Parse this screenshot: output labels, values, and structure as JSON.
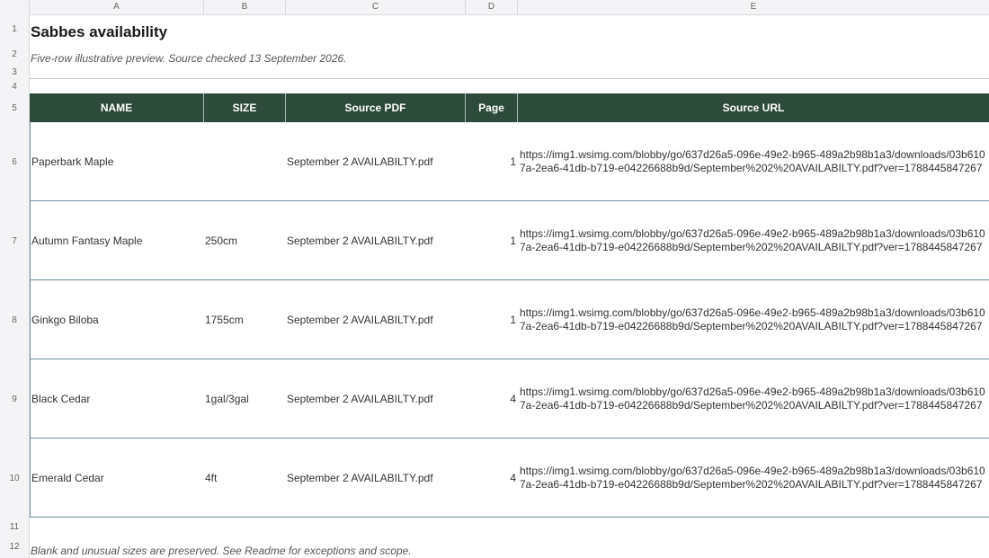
{
  "sheet": {
    "column_letters": [
      "A",
      "B",
      "C",
      "D",
      "E"
    ],
    "row_numbers": [
      "1",
      "2",
      "3",
      "4",
      "5",
      "6",
      "7",
      "8",
      "9",
      "10",
      "11",
      "12"
    ],
    "title": "Sabbes availability",
    "subtitle": "Five-row illustrative preview. Source checked 13 September 2026.",
    "footer_note": "Blank and unusual sizes are preserved. See Readme for exceptions and scope."
  },
  "table": {
    "headers": [
      "NAME",
      "SIZE",
      "Source PDF",
      "Page",
      "Source URL"
    ],
    "header_color": "#2e4a3b",
    "rows": [
      {
        "name": "Paperbark Maple",
        "size": "",
        "pdf": "September 2 AVAILABILTY.pdf",
        "page": "1",
        "url": "https://img1.wsimg.com/blobby/go/637d26a5-096e-49e2-b965-489a2b98b1a3/downloads/03b6107a-2ea6-41db-b719-e04226688b9d/September%202%20AVAILABILTY.pdf?ver=1788445847267"
      },
      {
        "name": "Autumn Fantasy Maple",
        "size": "250cm",
        "pdf": "September 2 AVAILABILTY.pdf",
        "page": "1",
        "url": "https://img1.wsimg.com/blobby/go/637d26a5-096e-49e2-b965-489a2b98b1a3/downloads/03b6107a-2ea6-41db-b719-e04226688b9d/September%202%20AVAILABILTY.pdf?ver=1788445847267"
      },
      {
        "name": "Ginkgo Biloba",
        "size": "1755cm",
        "pdf": "September 2 AVAILABILTY.pdf",
        "page": "1",
        "url": "https://img1.wsimg.com/blobby/go/637d26a5-096e-49e2-b965-489a2b98b1a3/downloads/03b6107a-2ea6-41db-b719-e04226688b9d/September%202%20AVAILABILTY.pdf?ver=1788445847267"
      },
      {
        "name": "Black Cedar",
        "size": "1gal/3gal",
        "pdf": "September 2 AVAILABILTY.pdf",
        "page": "4",
        "url": "https://img1.wsimg.com/blobby/go/637d26a5-096e-49e2-b965-489a2b98b1a3/downloads/03b6107a-2ea6-41db-b719-e04226688b9d/September%202%20AVAILABILTY.pdf?ver=1788445847267"
      },
      {
        "name": "Emerald Cedar",
        "size": "4ft",
        "pdf": "September 2 AVAILABILTY.pdf",
        "page": "4",
        "url": "https://img1.wsimg.com/blobby/go/637d26a5-096e-49e2-b965-489a2b98b1a3/downloads/03b6107a-2ea6-41db-b719-e04226688b9d/September%202%20AVAILABILTY.pdf?ver=1788445847267"
      }
    ]
  }
}
